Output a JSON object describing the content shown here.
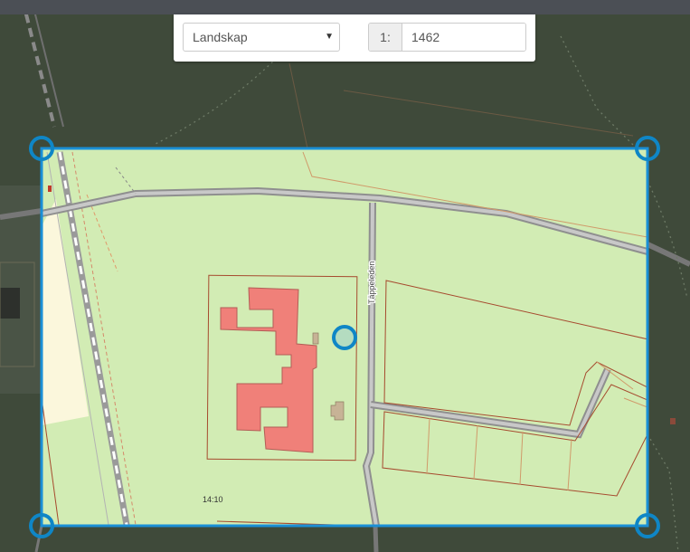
{
  "print_controls": {
    "layout_select": {
      "selected": "Landskap"
    },
    "scale": {
      "prefix": "1:",
      "value": "1462"
    }
  },
  "map": {
    "road_label": "Täppeleden",
    "parcel_label": "14:10"
  },
  "colors": {
    "frame_outline": "#1a8fd6",
    "handle": "#0f86c6",
    "land": "#d2ecb4",
    "building": "#f08079",
    "dark_overlay": "#3f4a3a"
  }
}
